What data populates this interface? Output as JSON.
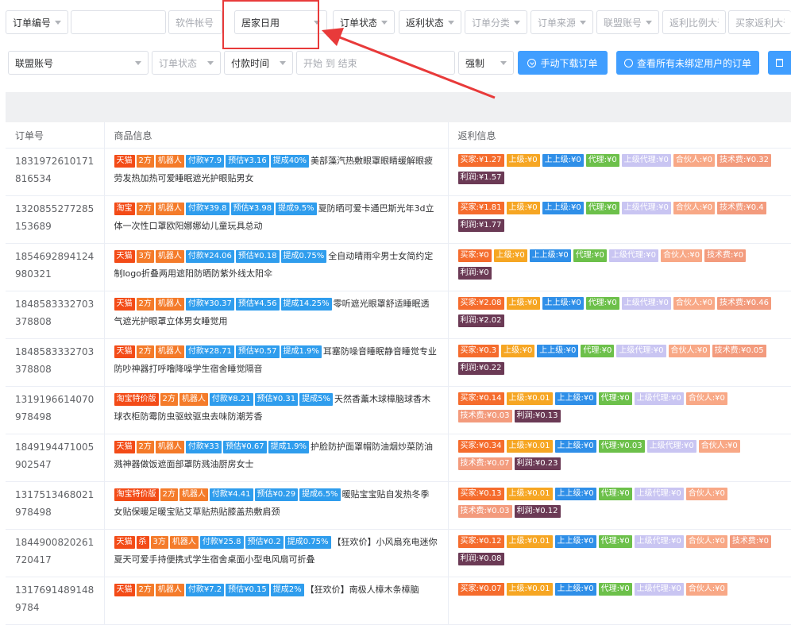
{
  "filters_row1": [
    {
      "label": "订单编号",
      "kind": "select"
    },
    {
      "label": "",
      "kind": "input"
    },
    {
      "label": "软件帐号",
      "kind": "placeholder"
    },
    {
      "label": "居家日用",
      "kind": "select"
    },
    {
      "label": "订单状态",
      "kind": "select"
    },
    {
      "label": "返利状态",
      "kind": "select"
    },
    {
      "label": "订单分类",
      "kind": "select"
    },
    {
      "label": "订单来源",
      "kind": "select"
    },
    {
      "label": "联盟账号",
      "kind": "select"
    },
    {
      "label": "返利比例大于",
      "kind": "placeholder"
    },
    {
      "label": "买家返利大于",
      "kind": "placeholder"
    }
  ],
  "filters_row2": {
    "alliance": "联盟账号",
    "order_status": "订单状态",
    "pay_time": "付款时间",
    "date_range": "开始 到 结束",
    "force": "强制",
    "download_btn": "手动下载订单",
    "view_btn": "查看所有未绑定用户的订单"
  },
  "table": {
    "headers": [
      "订单号",
      "商品信息",
      "返利信息"
    ],
    "rows": [
      {
        "id": "1831972610171816534",
        "tags": [
          [
            "天猫",
            "red"
          ],
          [
            "2方",
            "orange"
          ],
          [
            "机器人",
            "orange"
          ],
          [
            "付款¥7.9",
            "blue"
          ],
          [
            "预估¥3.16",
            "blue"
          ],
          [
            "提成40%",
            "blue"
          ]
        ],
        "title": "美部藻汽热敷眼罩眼睛缓解眼疲劳发热加热可爱睡眠遮光护眼贴男女",
        "rebate": [
          "买家:¥1.27",
          "上级:¥0",
          "上上级:¥0",
          "代理:¥0",
          "上级代理:¥0",
          "合伙人:¥0",
          "技术费:¥0.32",
          "利润:¥1.57"
        ]
      },
      {
        "id": "1320855277285153689",
        "tags": [
          [
            "淘宝",
            "red"
          ],
          [
            "2方",
            "orange"
          ],
          [
            "机器人",
            "orange"
          ],
          [
            "付款¥39.8",
            "blue"
          ],
          [
            "预估¥3.98",
            "blue"
          ],
          [
            "提成9.5%",
            "blue"
          ]
        ],
        "title": "夏防晒可爱卡通巴斯光年3d立体一次性口罩欧阳娜娜幼儿童玩具总动",
        "rebate": [
          "买家:¥1.81",
          "上级:¥0",
          "上上级:¥0",
          "代理:¥0",
          "上级代理:¥0",
          "合伙人:¥0",
          "技术费:¥0.4",
          "利润:¥1.77"
        ]
      },
      {
        "id": "1854692894124980321",
        "tags": [
          [
            "天猫",
            "red"
          ],
          [
            "3方",
            "orange"
          ],
          [
            "机器人",
            "orange"
          ],
          [
            "付款¥24.06",
            "blue"
          ],
          [
            "预估¥0.18",
            "blue"
          ],
          [
            "提成0.75%",
            "blue"
          ]
        ],
        "title": "全自动晴雨伞男士女简约定制logo折叠两用遮阳防晒防紫外线太阳伞",
        "rebate": [
          "买家:¥0",
          "上级:¥0",
          "上上级:¥0",
          "代理:¥0",
          "上级代理:¥0",
          "合伙人:¥0",
          "技术费:¥0",
          "利润:¥0"
        ]
      },
      {
        "id": "1848583332703378808",
        "tags": [
          [
            "天猫",
            "red"
          ],
          [
            "2方",
            "orange"
          ],
          [
            "机器人",
            "orange"
          ],
          [
            "付款¥30.37",
            "blue"
          ],
          [
            "预估¥4.56",
            "blue"
          ],
          [
            "提成14.25%",
            "blue"
          ]
        ],
        "title": "零听遮光眼罩舒适睡眠透气遮光护眼罩立体男女睡觉用",
        "rebate": [
          "买家:¥2.08",
          "上级:¥0",
          "上上级:¥0",
          "代理:¥0",
          "上级代理:¥0",
          "合伙人:¥0",
          "技术费:¥0.46",
          "利润:¥2.02"
        ]
      },
      {
        "id": "1848583332703378808",
        "tags": [
          [
            "天猫",
            "red"
          ],
          [
            "2方",
            "orange"
          ],
          [
            "机器人",
            "orange"
          ],
          [
            "付款¥28.71",
            "blue"
          ],
          [
            "预估¥0.57",
            "blue"
          ],
          [
            "提成1.9%",
            "blue"
          ]
        ],
        "title": "耳塞防噪音睡眠静音睡觉专业防吵神器打呼噜降噪学生宿舍睡觉隔音",
        "rebate": [
          "买家:¥0.3",
          "上级:¥0",
          "上上级:¥0",
          "代理:¥0",
          "上级代理:¥0",
          "合伙人:¥0",
          "技术费:¥0.05",
          "利润:¥0.22"
        ]
      },
      {
        "id": "1319196614070978498",
        "tags": [
          [
            "淘宝特价版",
            "red"
          ],
          [
            "2方",
            "orange"
          ],
          [
            "机器人",
            "orange"
          ],
          [
            "付款¥8.21",
            "blue"
          ],
          [
            "预估¥0.31",
            "blue"
          ],
          [
            "提成5%",
            "blue"
          ]
        ],
        "title": "天然香薰木球樟脑球香木球衣柜防霉防虫驱蚊驱虫去味防潮芳香",
        "rebate": [
          "买家:¥0.14",
          "上级:¥0.01",
          "上上级:¥0",
          "代理:¥0",
          "上级代理:¥0",
          "合伙人:¥0",
          "技术费:¥0.03",
          "利润:¥0.13"
        ]
      },
      {
        "id": "1849194471005902547",
        "tags": [
          [
            "天猫",
            "red"
          ],
          [
            "2方",
            "orange"
          ],
          [
            "机器人",
            "orange"
          ],
          [
            "付款¥33",
            "blue"
          ],
          [
            "预估¥0.67",
            "blue"
          ],
          [
            "提成1.9%",
            "blue"
          ]
        ],
        "title": "护脸防护面罩帽防油烟炒菜防油溅神器做饭遮面部罩防溅油厨房女士",
        "rebate": [
          "买家:¥0.34",
          "上级:¥0.01",
          "上上级:¥0",
          "代理:¥0.03",
          "上级代理:¥0",
          "合伙人:¥0",
          "技术费:¥0.07",
          "利润:¥0.23"
        ]
      },
      {
        "id": "1317513468021978498",
        "tags": [
          [
            "淘宝特价版",
            "red"
          ],
          [
            "2方",
            "orange"
          ],
          [
            "机器人",
            "orange"
          ],
          [
            "付款¥4.41",
            "blue"
          ],
          [
            "预估¥0.29",
            "blue"
          ],
          [
            "提成6.5%",
            "blue"
          ]
        ],
        "title": "暖贴宝宝贴自发热冬季女贴保暖足暖宝贴艾草贴热贴膝盖热敷肩颈",
        "rebate": [
          "买家:¥0.13",
          "上级:¥0.01",
          "上上级:¥0",
          "代理:¥0",
          "上级代理:¥0",
          "合伙人:¥0",
          "技术费:¥0.03",
          "利润:¥0.12"
        ]
      },
      {
        "id": "1844900820261720417",
        "tags": [
          [
            "天猫",
            "red"
          ],
          [
            "杀",
            "red"
          ],
          [
            "3方",
            "orange"
          ],
          [
            "机器人",
            "orange"
          ],
          [
            "付款¥25.8",
            "blue"
          ],
          [
            "预估¥0.2",
            "blue"
          ],
          [
            "提成0.75%",
            "blue"
          ]
        ],
        "title": "【狂欢价】小风扇充电迷你夏天可爱手持便携式学生宿舍桌面小型电风扇可折叠",
        "rebate": [
          "买家:¥0.12",
          "上级:¥0.01",
          "上上级:¥0",
          "代理:¥0",
          "上级代理:¥0",
          "合伙人:¥0",
          "技术费:¥0",
          "利润:¥0.08"
        ]
      },
      {
        "id": "13176914891489784",
        "tags": [
          [
            "天猫",
            "red"
          ],
          [
            "2方",
            "orange"
          ],
          [
            "机器人",
            "orange"
          ],
          [
            "付款¥7.2",
            "blue"
          ],
          [
            "预估¥0.15",
            "blue"
          ],
          [
            "提成2%",
            "blue"
          ]
        ],
        "title": "【狂欢价】南极人樟木条樟脑",
        "rebate": [
          "买家:¥0.07",
          "上级:¥0.01",
          "上上级:¥0",
          "代理:¥0",
          "上级代理:¥0",
          "合伙人:¥0"
        ]
      }
    ]
  },
  "colors": {
    "accent": "#409eff",
    "highlight": "#e83a3a"
  }
}
